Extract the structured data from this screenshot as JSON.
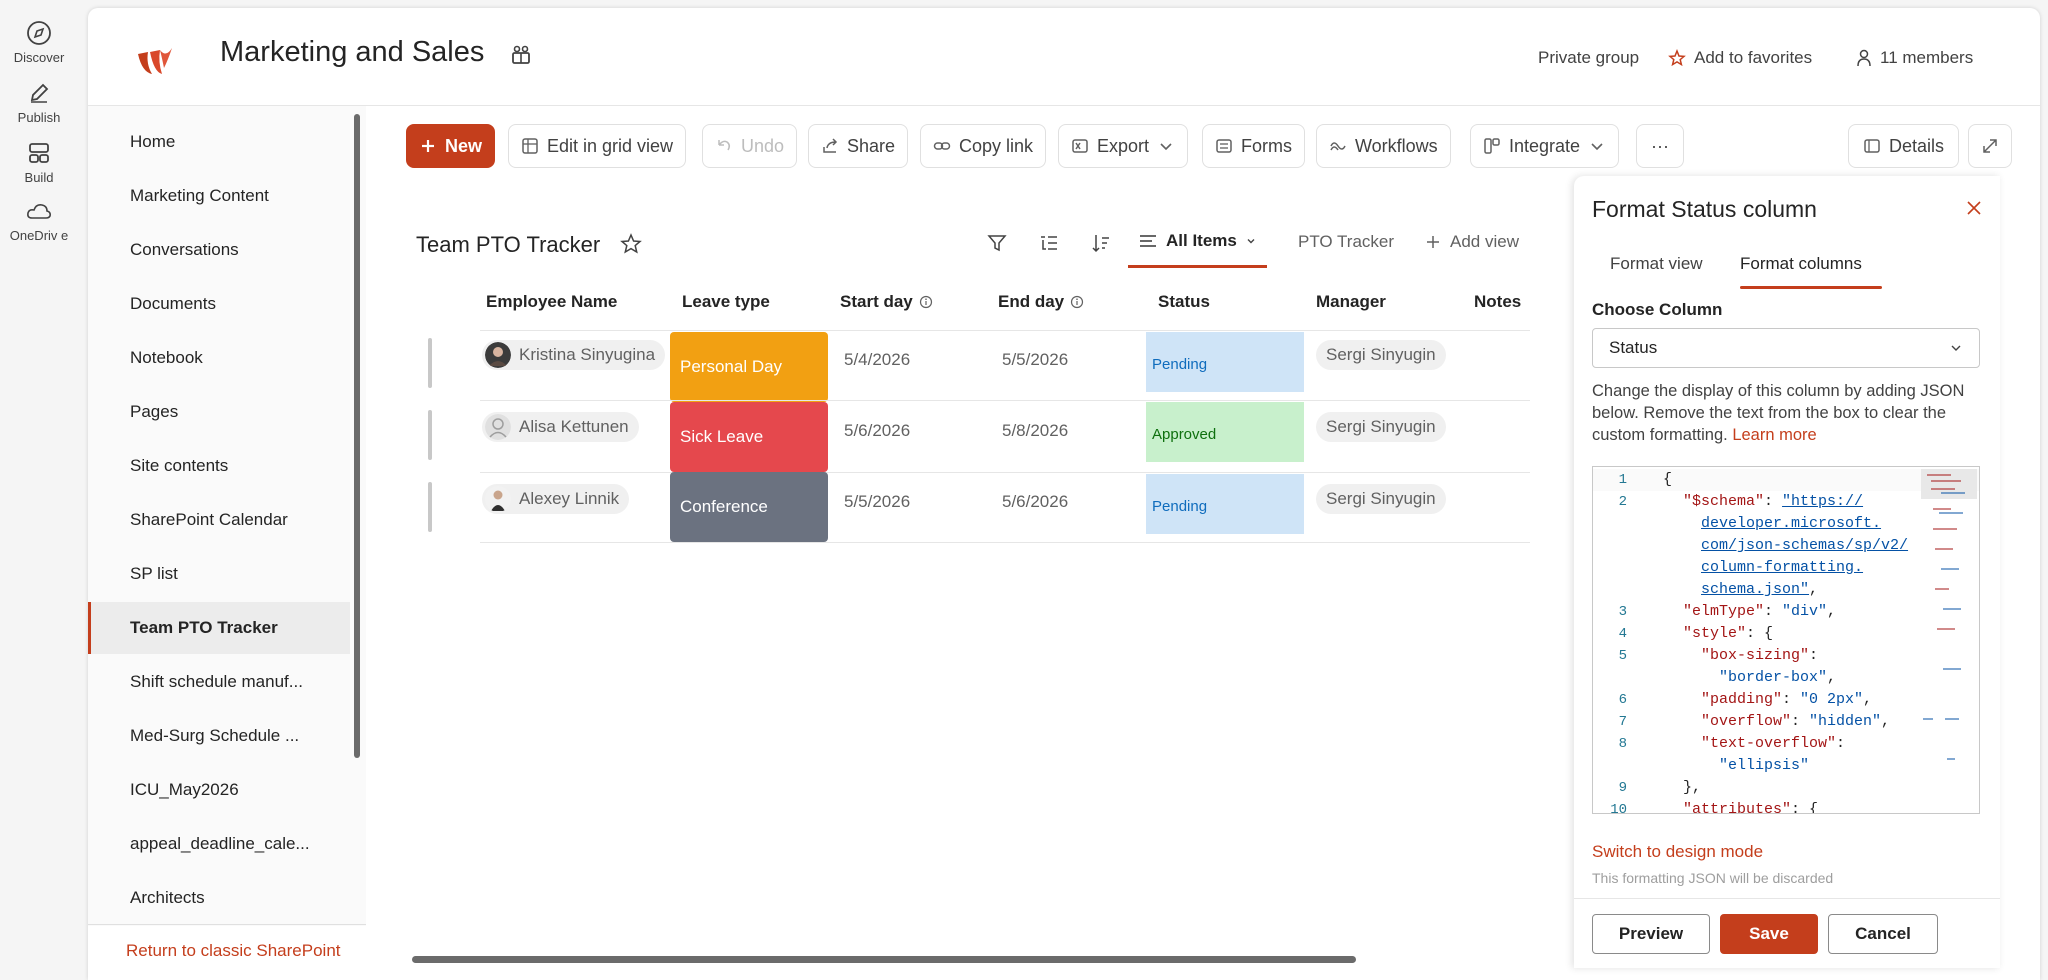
{
  "appbar": {
    "items": [
      {
        "label": "Discover",
        "icon": "compass-icon"
      },
      {
        "label": "Publish",
        "icon": "pen-icon"
      },
      {
        "label": "Build",
        "icon": "layout-icon"
      },
      {
        "label": "OneDriv e",
        "icon": "cloud-icon"
      }
    ]
  },
  "site": {
    "title": "Marketing and Sales",
    "group_type": "Private group",
    "favorites_label": "Add to favorites",
    "members_label": "11 members",
    "brand_color": "#c43e1c"
  },
  "leftnav": {
    "items": [
      "Home",
      "Marketing Content",
      "Conversations",
      "Documents",
      "Notebook",
      "Pages",
      "Site contents",
      "SharePoint Calendar",
      "SP list",
      "Team PTO Tracker",
      "Shift schedule manuf...",
      "Med-Surg Schedule ...",
      "ICU_May2026",
      "appeal_deadline_cale...",
      "Architects"
    ],
    "selected": "Team PTO Tracker",
    "return_classic": "Return to classic SharePoint"
  },
  "commandbar": {
    "new": "New",
    "edit_grid": "Edit in grid view",
    "undo": "Undo",
    "share": "Share",
    "copy_link": "Copy link",
    "export": "Export",
    "forms": "Forms",
    "workflows": "Workflows",
    "integrate": "Integrate",
    "more": "···",
    "details": "Details"
  },
  "list": {
    "title": "Team PTO Tracker",
    "views": {
      "active": "All Items",
      "other": "PTO Tracker",
      "add": "Add view"
    },
    "columns": [
      "Employee Name",
      "Leave type",
      "Start day",
      "End day",
      "Status",
      "Manager",
      "Notes"
    ],
    "rows": [
      {
        "employee": "Kristina Sinyugina",
        "leave": "Personal Day",
        "leave_color": "#f2a012",
        "start": "5/4/2026",
        "end": "5/5/2026",
        "status": "Pending",
        "manager": "Sergi Sinyugin"
      },
      {
        "employee": "Alisa Kettunen",
        "leave": "Sick Leave",
        "leave_color": "#e5484d",
        "start": "5/6/2026",
        "end": "5/8/2026",
        "status": "Approved",
        "manager": "Sergi Sinyugin"
      },
      {
        "employee": "Alexey Linnik",
        "leave": "Conference",
        "leave_color": "#6b7280",
        "start": "5/5/2026",
        "end": "5/6/2026",
        "status": "Pending",
        "manager": "Sergi Sinyugin"
      }
    ]
  },
  "panel": {
    "title": "Format Status column",
    "tabs": [
      "Format view",
      "Format columns"
    ],
    "active_tab": "Format columns",
    "choose_label": "Choose Column",
    "column_value": "Status",
    "description": "Change the display of this column by adding JSON below. Remove the text from the box to clear the custom formatting.",
    "learn_more": "Learn more",
    "code": {
      "l1_brace": "{",
      "schema_key": "\"$schema\"",
      "schema_url_1": "\"https://",
      "schema_url_2": "developer.microsoft.",
      "schema_url_3": "com/json-schemas/sp/v2/",
      "schema_url_4": "column-formatting.",
      "schema_url_5": "schema.json\"",
      "elm_key": "\"elmType\"",
      "elm_val": "\"div\"",
      "style_key": "\"style\"",
      "box_key": "\"box-sizing\"",
      "box_val": "\"border-box\"",
      "padding_key": "\"padding\"",
      "padding_val": "\"0 2px\"",
      "overflow_key": "\"overflow\"",
      "overflow_val": "\"hidden\"",
      "textov_key": "\"text-overflow\"",
      "textov_val": "\"ellipsis\"",
      "close_brace": "},",
      "attr_key": "\"attributes\""
    },
    "design_mode": "Switch to design mode",
    "discard_note": "This formatting JSON will be discarded",
    "buttons": {
      "preview": "Preview",
      "save": "Save",
      "cancel": "Cancel"
    }
  }
}
